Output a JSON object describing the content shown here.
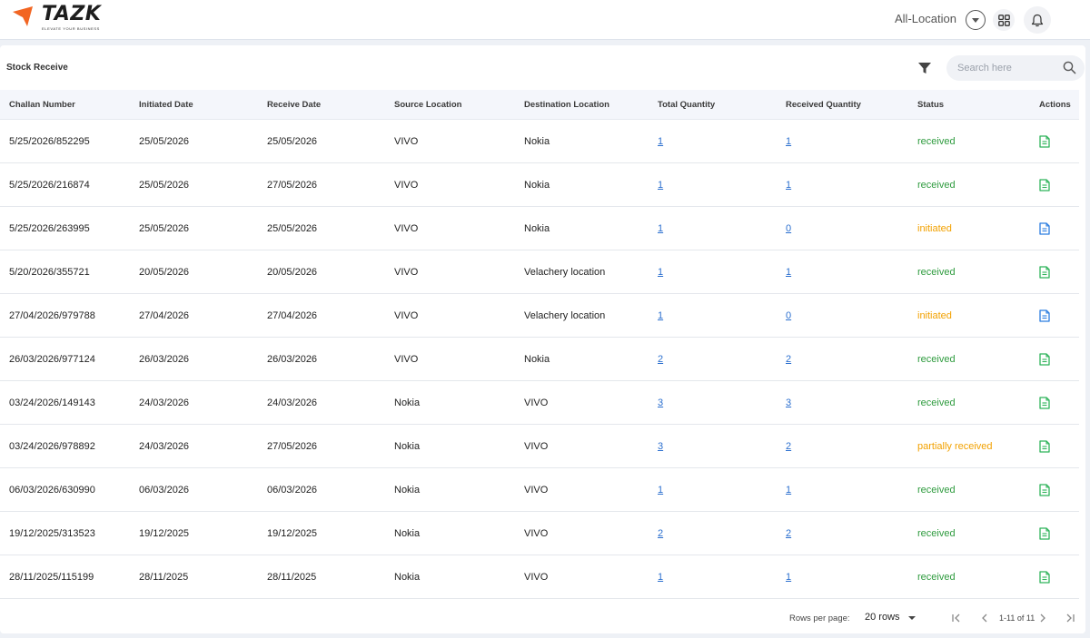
{
  "app": {
    "logo_text": "TAZK",
    "logo_tagline": "ELEVATE YOUR BUSINESS"
  },
  "header": {
    "location_label": "All-Location"
  },
  "page": {
    "title": "Stock Receive",
    "search_placeholder": "Search here"
  },
  "table": {
    "columns": [
      "Challan Number",
      "Initiated Date",
      "Receive Date",
      "Source Location",
      "Destination Location",
      "Total Quantity",
      "Received Quantity",
      "Status",
      "Actions"
    ],
    "rows": [
      {
        "challan": "5/25/2026/852295",
        "initiated": "25/05/2026",
        "received_date": "25/05/2026",
        "source": "VIVO",
        "destination": "Nokia",
        "total": "1",
        "received_qty": "1",
        "status": "received"
      },
      {
        "challan": "5/25/2026/216874",
        "initiated": "25/05/2026",
        "received_date": "27/05/2026",
        "source": "VIVO",
        "destination": "Nokia",
        "total": "1",
        "received_qty": "1",
        "status": "received"
      },
      {
        "challan": "5/25/2026/263995",
        "initiated": "25/05/2026",
        "received_date": "25/05/2026",
        "source": "VIVO",
        "destination": "Nokia",
        "total": "1",
        "received_qty": "0",
        "status": "initiated"
      },
      {
        "challan": "5/20/2026/355721",
        "initiated": "20/05/2026",
        "received_date": "20/05/2026",
        "source": "VIVO",
        "destination": "Velachery location",
        "total": "1",
        "received_qty": "1",
        "status": "received"
      },
      {
        "challan": "27/04/2026/979788",
        "initiated": "27/04/2026",
        "received_date": "27/04/2026",
        "source": "VIVO",
        "destination": "Velachery location",
        "total": "1",
        "received_qty": "0",
        "status": "initiated"
      },
      {
        "challan": "26/03/2026/977124",
        "initiated": "26/03/2026",
        "received_date": "26/03/2026",
        "source": "VIVO",
        "destination": "Nokia",
        "total": "2",
        "received_qty": "2",
        "status": "received"
      },
      {
        "challan": "03/24/2026/149143",
        "initiated": "24/03/2026",
        "received_date": "24/03/2026",
        "source": "Nokia",
        "destination": "VIVO",
        "total": "3",
        "received_qty": "3",
        "status": "received"
      },
      {
        "challan": "03/24/2026/978892",
        "initiated": "24/03/2026",
        "received_date": "27/05/2026",
        "source": "Nokia",
        "destination": "VIVO",
        "total": "3",
        "received_qty": "2",
        "status": "partially received"
      },
      {
        "challan": "06/03/2026/630990",
        "initiated": "06/03/2026",
        "received_date": "06/03/2026",
        "source": "Nokia",
        "destination": "VIVO",
        "total": "1",
        "received_qty": "1",
        "status": "received"
      },
      {
        "challan": "19/12/2025/313523",
        "initiated": "19/12/2025",
        "received_date": "19/12/2025",
        "source": "Nokia",
        "destination": "VIVO",
        "total": "2",
        "received_qty": "2",
        "status": "received"
      },
      {
        "challan": "28/11/2025/115199",
        "initiated": "28/11/2025",
        "received_date": "28/11/2025",
        "source": "Nokia",
        "destination": "VIVO",
        "total": "1",
        "received_qty": "1",
        "status": "received"
      }
    ]
  },
  "pagination": {
    "rows_per_page_label": "Rows per page:",
    "rows_per_page_value": "20 rows",
    "range_text": "1-11 of 11"
  },
  "colors": {
    "brand_orange": "#f26522",
    "status_received": "#2e9b3e",
    "status_initiated": "#f2a100",
    "link_blue": "#2b6fcf",
    "action_green": "#2fb35a",
    "action_blue": "#2b7de0"
  }
}
